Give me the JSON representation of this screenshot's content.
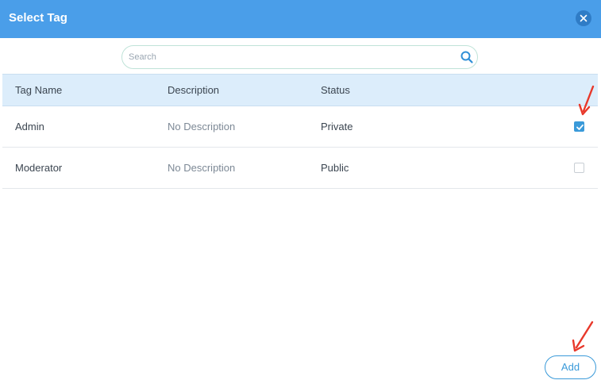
{
  "dialog": {
    "title": "Select Tag",
    "close_icon": "close-icon"
  },
  "search": {
    "placeholder": "Search",
    "value": "",
    "icon": "search-icon"
  },
  "table": {
    "columns": [
      "Tag Name",
      "Description",
      "Status"
    ],
    "rows": [
      {
        "name": "Admin",
        "description": "No Description",
        "status": "Private",
        "selected": true
      },
      {
        "name": "Moderator",
        "description": "No Description",
        "status": "Public",
        "selected": false
      }
    ]
  },
  "footer": {
    "add_label": "Add"
  },
  "colors": {
    "header": "#4a9ee9",
    "table_header": "#dcedfb",
    "accent": "#3a9ad9",
    "annotation_arrow": "#e8382a"
  }
}
